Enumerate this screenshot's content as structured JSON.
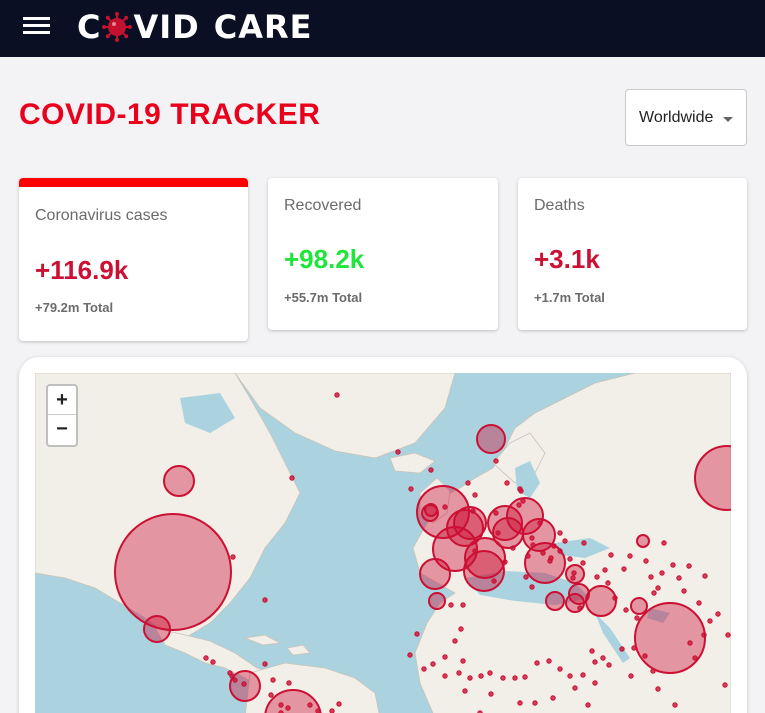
{
  "navbar": {
    "brand_first": "C",
    "brand_rest": "VID",
    "brand_second": "CARE"
  },
  "header": {
    "title": "COVID-19 TRACKER",
    "country_select": "Worldwide"
  },
  "cards": [
    {
      "title": "Coronavirus cases",
      "value": "+116.9k",
      "total": "+79.2m Total",
      "value_color": "#cc1034",
      "selected": true
    },
    {
      "title": "Recovered",
      "value": "+98.2k",
      "total": "+55.7m Total",
      "value_color": "#1ee63a",
      "selected": false
    },
    {
      "title": "Deaths",
      "value": "+3.1k",
      "total": "+1.7m Total",
      "value_color": "#cc1034",
      "selected": false
    }
  ],
  "map": {
    "zoom_in": "+",
    "zoom_out": "−",
    "ocean_color": "#aad3df",
    "land_color": "#f2efe9",
    "circle_color": "#cc1034"
  }
}
